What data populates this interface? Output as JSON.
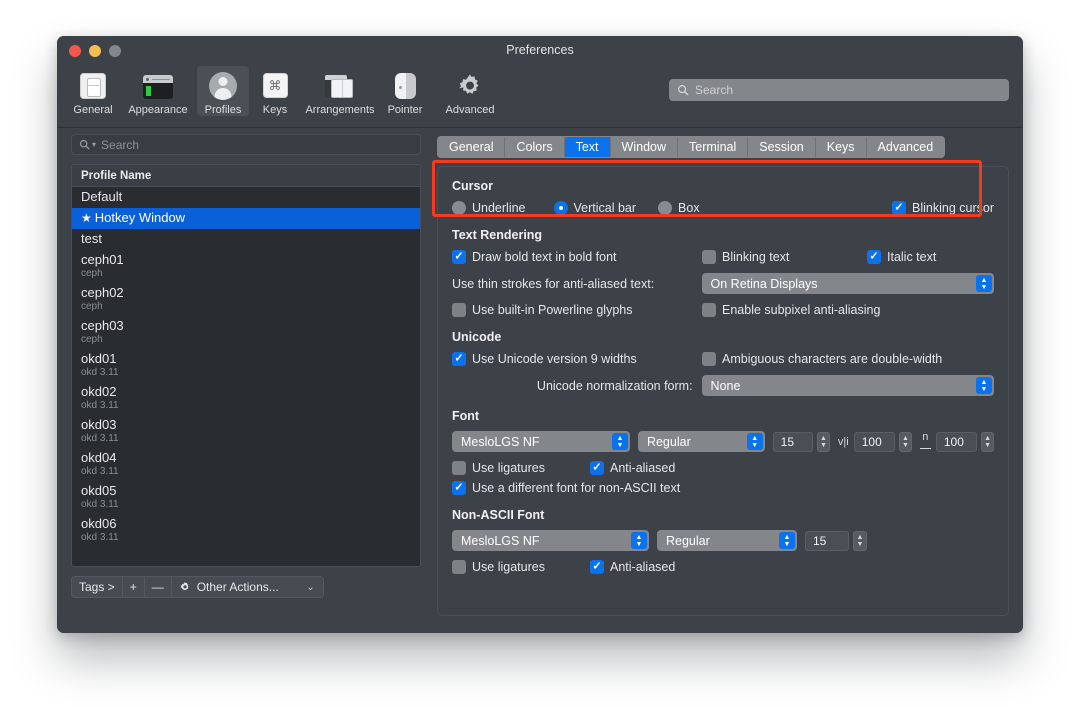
{
  "window": {
    "title": "Preferences",
    "traffic": [
      "close",
      "minimize",
      "zoom"
    ]
  },
  "toolbar": {
    "items": [
      {
        "label": "General",
        "icon": "general-icon"
      },
      {
        "label": "Appearance",
        "icon": "appearance-icon"
      },
      {
        "label": "Profiles",
        "icon": "profiles-icon",
        "selected": true
      },
      {
        "label": "Keys",
        "icon": "command-key-icon"
      },
      {
        "label": "Arrangements",
        "icon": "arrangements-icon"
      },
      {
        "label": "Pointer",
        "icon": "pointer-icon"
      },
      {
        "label": "Advanced",
        "icon": "gear-icon"
      }
    ],
    "search_placeholder": "Search"
  },
  "sidebar": {
    "search_placeholder": "Search",
    "column_header": "Profile Name",
    "profiles": [
      {
        "name": "Default",
        "tag": "",
        "selected": false,
        "starred": false
      },
      {
        "name": "Hotkey Window",
        "tag": "",
        "selected": true,
        "starred": true
      },
      {
        "name": "test",
        "tag": "",
        "selected": false,
        "starred": false
      },
      {
        "name": "ceph01",
        "tag": "ceph",
        "selected": false,
        "starred": false
      },
      {
        "name": "ceph02",
        "tag": "ceph",
        "selected": false,
        "starred": false
      },
      {
        "name": "ceph03",
        "tag": "ceph",
        "selected": false,
        "starred": false
      },
      {
        "name": "okd01",
        "tag": "okd 3.11",
        "selected": false,
        "starred": false
      },
      {
        "name": "okd02",
        "tag": "okd 3.11",
        "selected": false,
        "starred": false
      },
      {
        "name": "okd03",
        "tag": "okd 3.11",
        "selected": false,
        "starred": false
      },
      {
        "name": "okd04",
        "tag": "okd 3.11",
        "selected": false,
        "starred": false
      },
      {
        "name": "okd05",
        "tag": "okd 3.11",
        "selected": false,
        "starred": false
      },
      {
        "name": "okd06",
        "tag": "okd 3.11",
        "selected": false,
        "starred": false
      }
    ],
    "footer": {
      "tags_label": "Tags >",
      "add_label": "+",
      "remove_label": "—",
      "other_actions_label": "Other Actions...",
      "other_actions_chevron": "⌄"
    }
  },
  "tabs": [
    {
      "label": "General",
      "active": false
    },
    {
      "label": "Colors",
      "active": false
    },
    {
      "label": "Text",
      "active": true
    },
    {
      "label": "Window",
      "active": false
    },
    {
      "label": "Terminal",
      "active": false
    },
    {
      "label": "Session",
      "active": false
    },
    {
      "label": "Keys",
      "active": false
    },
    {
      "label": "Advanced",
      "active": false
    }
  ],
  "cursor": {
    "title": "Cursor",
    "options": [
      {
        "label": "Underline",
        "selected": false
      },
      {
        "label": "Vertical bar",
        "selected": true
      },
      {
        "label": "Box",
        "selected": false
      }
    ],
    "blinking_label": "Blinking cursor",
    "blinking_checked": true
  },
  "text_rendering": {
    "title": "Text Rendering",
    "bold_label": "Draw bold text in bold font",
    "bold_checked": true,
    "blinking_label": "Blinking text",
    "blinking_checked": false,
    "italic_label": "Italic text",
    "italic_checked": true,
    "thin_strokes_label": "Use thin strokes for anti-aliased text:",
    "thin_strokes_value": "On Retina Displays",
    "powerline_label": "Use built-in Powerline glyphs",
    "powerline_checked": false,
    "subpixel_label": "Enable subpixel anti-aliasing",
    "subpixel_checked": false
  },
  "unicode": {
    "title": "Unicode",
    "v9_label": "Use Unicode version 9 widths",
    "v9_checked": true,
    "ambiguous_label": "Ambiguous characters are double-width",
    "ambiguous_checked": false,
    "normalization_label": "Unicode normalization form:",
    "normalization_value": "None"
  },
  "font": {
    "title": "Font",
    "family": "MesloLGS NF",
    "weight": "Regular",
    "size": "15",
    "vertical_spacing": "100",
    "horizontal_spacing": "100",
    "vertical_spacing_icon": "vertical-spacing-icon",
    "horizontal_spacing_icon": "horizontal-spacing-icon",
    "ligatures_label": "Use ligatures",
    "ligatures_checked": false,
    "antialiased_label": "Anti-aliased",
    "antialiased_checked": true,
    "different_font_label": "Use a different font for non-ASCII text",
    "different_font_checked": true
  },
  "non_ascii_font": {
    "title": "Non-ASCII Font",
    "family": "MesloLGS NF",
    "weight": "Regular",
    "size": "15",
    "ligatures_label": "Use ligatures",
    "ligatures_checked": false,
    "antialiased_label": "Anti-aliased",
    "antialiased_checked": true
  },
  "annotation": {
    "color": "#f53a20"
  }
}
